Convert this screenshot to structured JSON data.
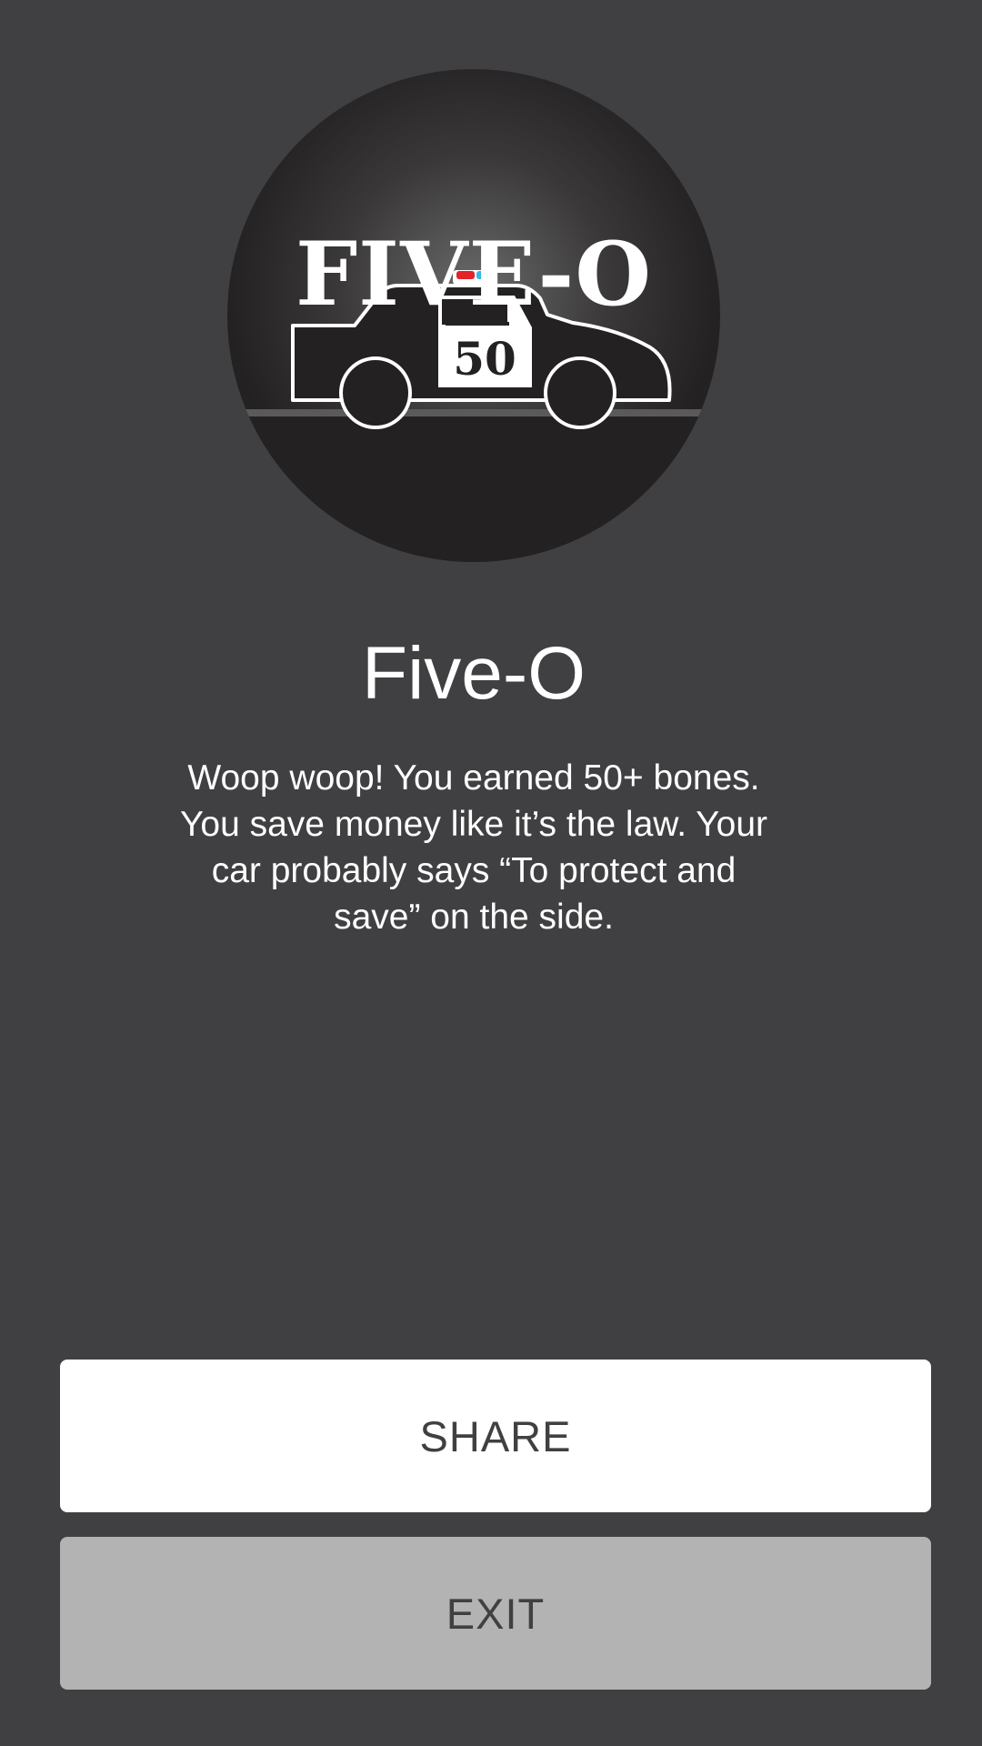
{
  "badge": {
    "title": "FIVE-O",
    "door_number": "50",
    "icon": "police-car-icon"
  },
  "achievement": {
    "title": "Five-O",
    "description": "Woop woop! You earned 50+ bones. You save money like it’s the law. Your car probably says “To protect and save” on the side."
  },
  "actions": {
    "share_label": "SHARE",
    "exit_label": "EXIT"
  },
  "colors": {
    "background": "#404042",
    "badge_dark": "#232122",
    "share_button": "#ffffff",
    "exit_button": "#b3b3b3",
    "siren_red": "#e2242a",
    "siren_blue": "#35b8e6"
  }
}
